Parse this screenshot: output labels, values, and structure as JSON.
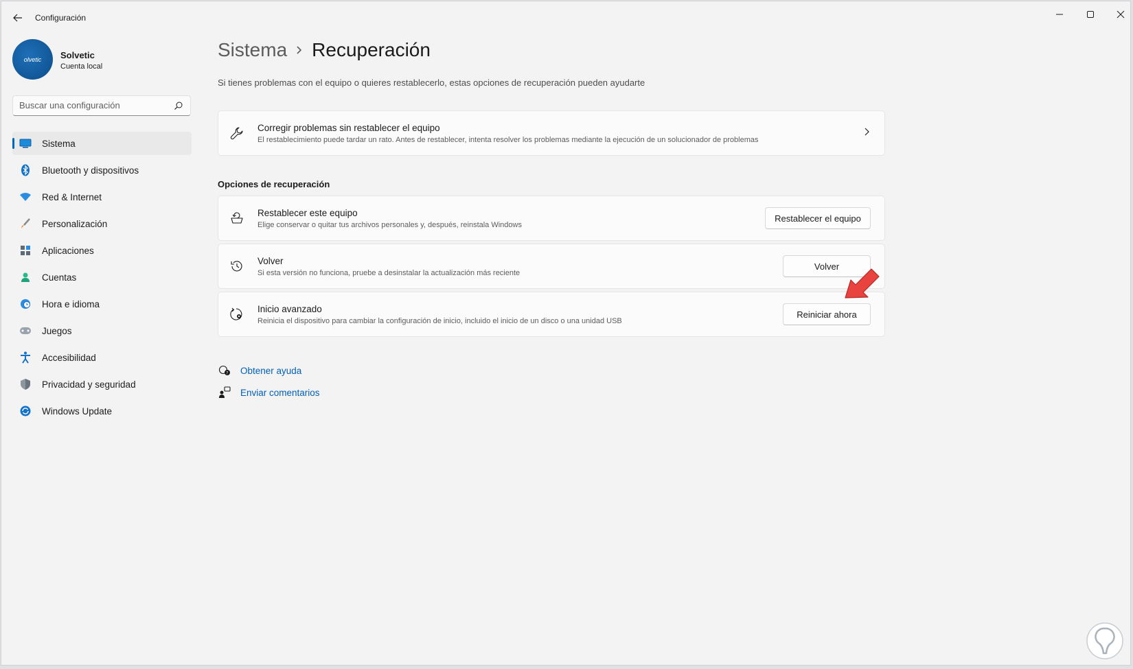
{
  "app": {
    "title": "Configuración"
  },
  "profile": {
    "name": "Solvetic",
    "account_type": "Cuenta local",
    "avatar_text": "olvetic"
  },
  "search": {
    "placeholder": "Buscar una configuración"
  },
  "sidebar": {
    "items": [
      {
        "label": "Sistema",
        "icon": "system-icon",
        "active": true
      },
      {
        "label": "Bluetooth y dispositivos",
        "icon": "bluetooth-icon"
      },
      {
        "label": "Red & Internet",
        "icon": "wifi-icon"
      },
      {
        "label": "Personalización",
        "icon": "brush-icon"
      },
      {
        "label": "Aplicaciones",
        "icon": "apps-icon"
      },
      {
        "label": "Cuentas",
        "icon": "person-icon"
      },
      {
        "label": "Hora e idioma",
        "icon": "clock-globe-icon"
      },
      {
        "label": "Juegos",
        "icon": "gamepad-icon"
      },
      {
        "label": "Accesibilidad",
        "icon": "accessibility-icon"
      },
      {
        "label": "Privacidad y seguridad",
        "icon": "shield-icon"
      },
      {
        "label": "Windows Update",
        "icon": "update-icon"
      }
    ]
  },
  "main": {
    "breadcrumb_parent": "Sistema",
    "breadcrumb_current": "Recuperación",
    "description": "Si tienes problemas con el equipo o quieres restablecerlo, estas opciones de recuperación pueden ayudarte",
    "fix_card": {
      "title": "Corregir problemas sin restablecer el equipo",
      "subtitle": "El restablecimiento puede tardar un rato. Antes de restablecer, intenta resolver los problemas mediante la ejecución de un solucionador de problemas"
    },
    "section_title": "Opciones de recuperación",
    "options": [
      {
        "title": "Restablecer este equipo",
        "subtitle": "Elige conservar o quitar tus archivos personales y, después, reinstala Windows",
        "button": "Restablecer el equipo"
      },
      {
        "title": "Volver",
        "subtitle": "Si esta versión no funciona, pruebe a desinstalar la actualización más reciente",
        "button": "Volver"
      },
      {
        "title": "Inicio avanzado",
        "subtitle": "Reinicia el dispositivo para cambiar la configuración de inicio, incluido el inicio de un disco o una unidad USB",
        "button": "Reiniciar ahora"
      }
    ],
    "links": [
      {
        "label": "Obtener ayuda",
        "icon": "help-icon"
      },
      {
        "label": "Enviar comentarios",
        "icon": "feedback-icon"
      }
    ]
  },
  "colors": {
    "accent": "#0067c0",
    "link": "#005fb8",
    "annotation_arrow": "#e8433f"
  }
}
